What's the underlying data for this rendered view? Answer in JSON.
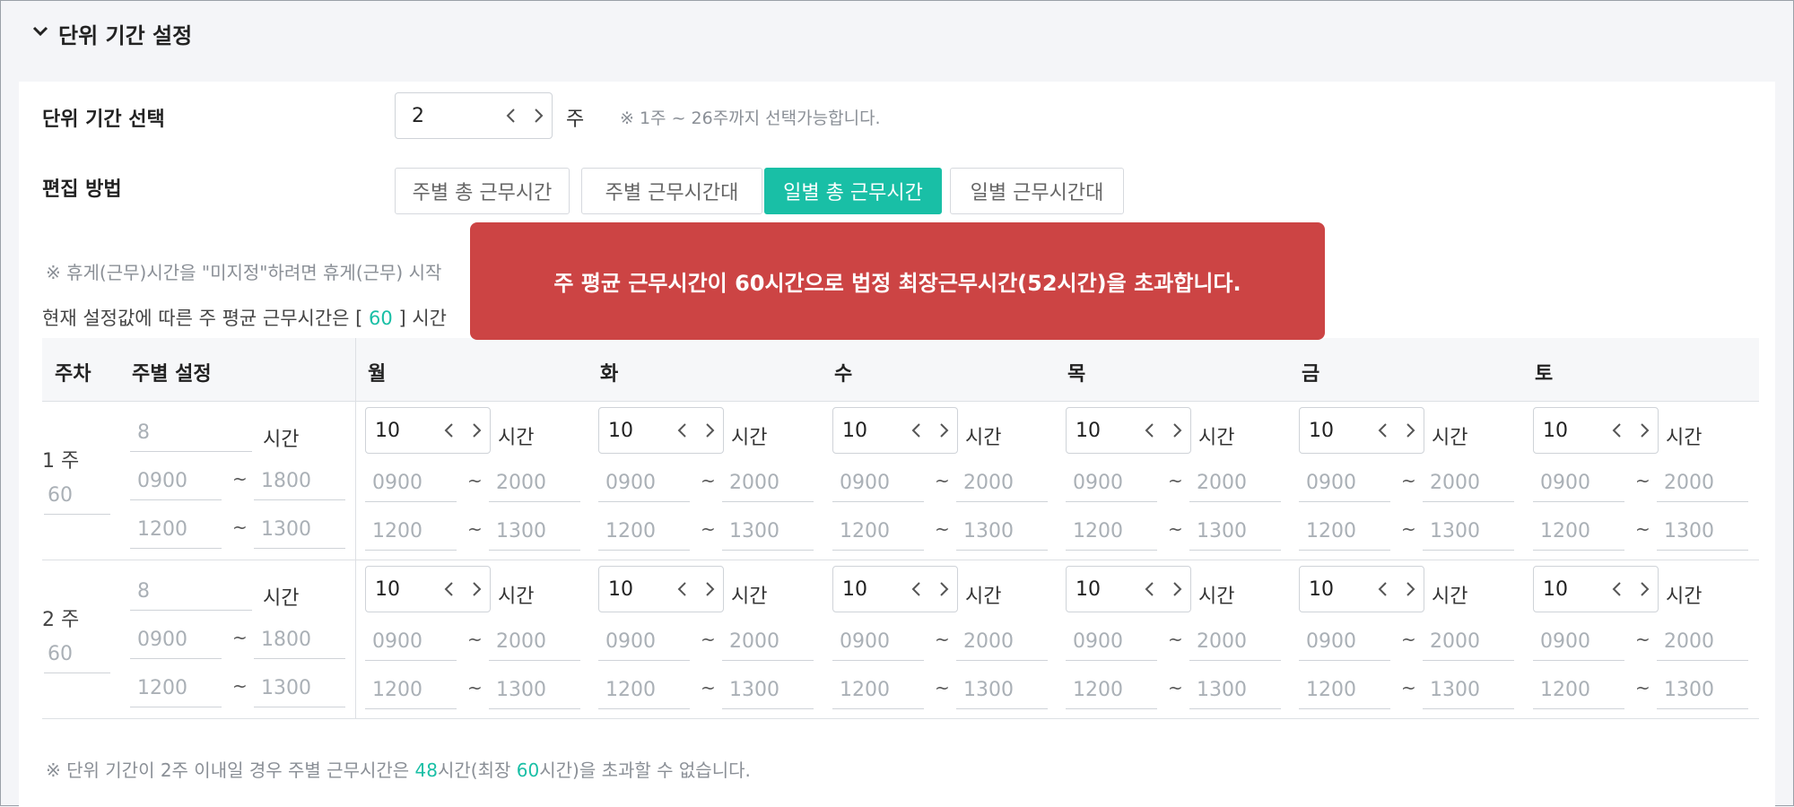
{
  "section": {
    "title": "단위 기간 설정"
  },
  "period": {
    "label": "단위 기간 선택",
    "value": "2",
    "unit": "주",
    "hint": "※ 1주 ~ 26주까지 선택가능합니다."
  },
  "edit": {
    "label": "편집 방법",
    "options": [
      "주별 총 근무시간",
      "주별 근무시간대",
      "일별 총 근무시간",
      "일별 근무시간대"
    ],
    "active_index": 2
  },
  "notes": {
    "break_prefix": "※  휴게(근무)시간을 \"미지정\"하려면 휴게(근무) 시작",
    "avg_prefix": "현재 설정값에 따른 주 평균 근무시간은 [ ",
    "avg_value": "60",
    "avg_suffix": " ] 시간",
    "footer_prefix": "※ 단위 기간이 2주 이내일 경우 주별 근무시간은 ",
    "footer_val1": "48",
    "footer_mid": "시간(최장 ",
    "footer_val2": "60",
    "footer_suffix": "시간)을 초과할 수 없습니다."
  },
  "toast": {
    "message": "주 평균 근무시간이 60시간으로 법정 최장근무시간(52시간)을 초과합니다."
  },
  "table": {
    "headers": {
      "week": "주차",
      "weekly": "주별 설정",
      "days": [
        "월",
        "화",
        "수",
        "목",
        "금",
        "토"
      ]
    },
    "hour_unit": "시간",
    "tilde": "~",
    "weeks": [
      {
        "label": "1 주",
        "total": "60",
        "weekly": {
          "hours": "8",
          "work_start": "0900",
          "work_end": "1800",
          "break_start": "1200",
          "break_end": "1300"
        },
        "day_hours": "10",
        "day_work_start": "0900",
        "day_work_end": "2000",
        "day_break_start": "1200",
        "day_break_end": "1300"
      },
      {
        "label": "2 주",
        "total": "60",
        "weekly": {
          "hours": "8",
          "work_start": "0900",
          "work_end": "1800",
          "break_start": "1200",
          "break_end": "1300"
        },
        "day_hours": "10",
        "day_work_start": "0900",
        "day_work_end": "2000",
        "day_break_start": "1200",
        "day_break_end": "1300"
      }
    ]
  },
  "colors": {
    "accent": "#19bfa6",
    "toast": "#cc4444"
  }
}
